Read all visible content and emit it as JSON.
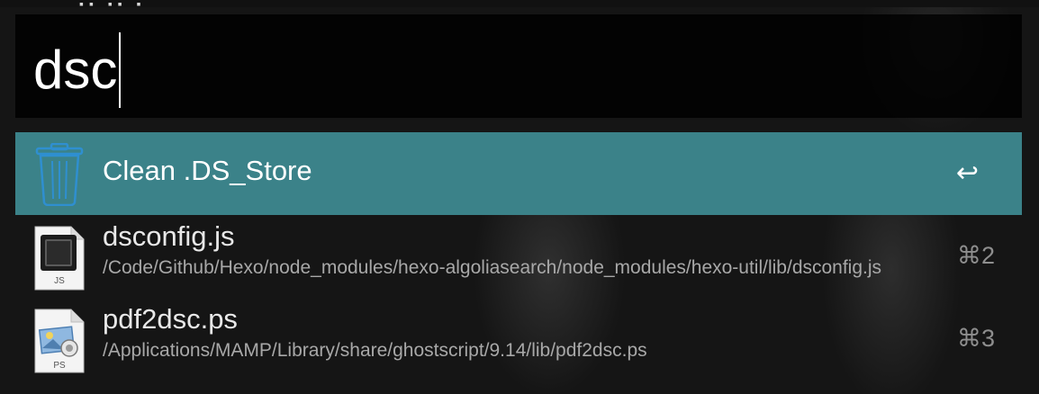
{
  "top_strip": {
    "text": "▪▪ ▪▪ ▪"
  },
  "search": {
    "query": "dsc"
  },
  "results": [
    {
      "title": "Clean .DS_Store",
      "subtitle": "",
      "shortcut": "↩",
      "icon": "trash-icon",
      "selected": true
    },
    {
      "title": "dsconfig.js",
      "subtitle": "/Code/Github/Hexo/node_modules/hexo-algoliasearch/node_modules/hexo-util/lib/dsconfig.js",
      "shortcut": "⌘2",
      "icon": "js-file-icon",
      "icon_label": "JS",
      "selected": false
    },
    {
      "title": "pdf2dsc.ps",
      "subtitle": "/Applications/MAMP/Library/share/ghostscript/9.14/lib/pdf2dsc.ps",
      "shortcut": "⌘3",
      "icon": "ps-file-icon",
      "icon_label": "PS",
      "selected": false
    }
  ],
  "colors": {
    "selection": "#3b8289",
    "background": "#151515",
    "trash_blue": "#2f8fd0"
  }
}
